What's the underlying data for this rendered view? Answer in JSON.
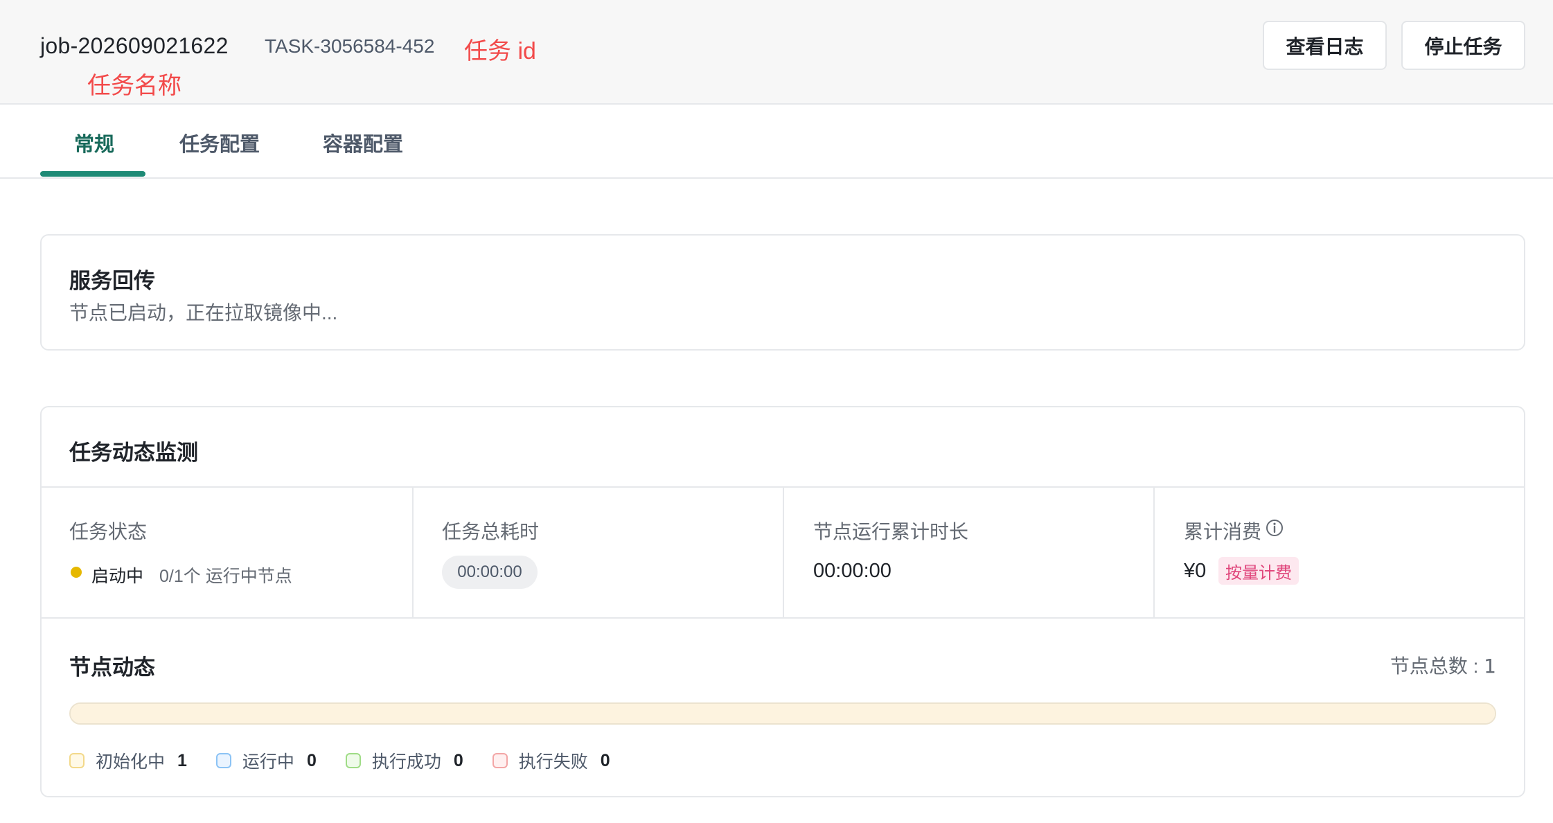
{
  "header": {
    "job_name": "job-202609021622",
    "task_id": "TASK-3056584-452",
    "annotation_task_id": "任务 id",
    "annotation_task_name": "任务名称",
    "view_logs_label": "查看日志",
    "stop_task_label": "停止任务"
  },
  "tabs": [
    {
      "label": "常规",
      "active": true
    },
    {
      "label": "任务配置",
      "active": false
    },
    {
      "label": "容器配置",
      "active": false
    }
  ],
  "service_callback": {
    "title": "服务回传",
    "message": "节点已启动，正在拉取镜像中..."
  },
  "monitor": {
    "title": "任务动态监测",
    "metrics": {
      "status_label": "任务状态",
      "status_value": "启动中",
      "status_sub": "0/1个 运行中节点",
      "status_color": "#e6b800",
      "total_time_label": "任务总耗时",
      "total_time_value": "00:00:00",
      "node_runtime_label": "节点运行累计时长",
      "node_runtime_value": "00:00:00",
      "cost_label": "累计消费",
      "cost_icon": "info-circle-icon",
      "cost_value": "¥0",
      "cost_tag": "按量计费"
    },
    "node_dynamics": {
      "title": "节点动态",
      "total_label": "节点总数",
      "total_value": "1",
      "progress_initializing_fraction": 1.0,
      "legend": [
        {
          "label": "初始化中",
          "count": "1",
          "color": "#f3d98a"
        },
        {
          "label": "运行中",
          "count": "0",
          "color": "#8cc3f5"
        },
        {
          "label": "执行成功",
          "count": "0",
          "color": "#9fdc86"
        },
        {
          "label": "执行失败",
          "count": "0",
          "color": "#f3a6a6"
        }
      ]
    }
  },
  "colors": {
    "accent": "#1e8a76",
    "annotation": "#f24a4a",
    "tag_text": "#e0457b"
  }
}
